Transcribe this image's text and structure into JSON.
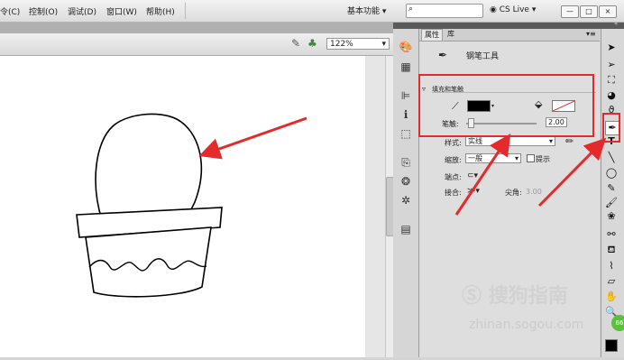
{
  "menu": {
    "items": [
      "令(C)",
      "控制(O)",
      "调试(D)",
      "窗口(W)",
      "帮助(H)"
    ],
    "workspace": "基本功能",
    "cs_live": "CS Live",
    "window_buttons": [
      "—",
      "□",
      "×"
    ]
  },
  "editbar": {
    "zoom": "122%"
  },
  "panel": {
    "tabs": [
      "属性",
      "库"
    ],
    "tool_name": "钢笔工具",
    "section_fill_stroke": "填充和笔触",
    "stroke_width_label": "笔触:",
    "stroke_width_value": "2.00",
    "style_label": "样式:",
    "style_value": "实线",
    "scale_label": "缩放:",
    "scale_value": "一般",
    "hint_label": "提示",
    "cap_label": "端点:",
    "join_label": "接合:",
    "miter_label": "尖角:",
    "miter_value": "3.00"
  },
  "colors": {
    "stroke": "#000000",
    "highlight": "#e42a2a",
    "canvas": "#ffffff"
  },
  "watermark": {
    "brand": "搜狗指南",
    "url": "zhinan.sogou.com",
    "badge": "66"
  }
}
